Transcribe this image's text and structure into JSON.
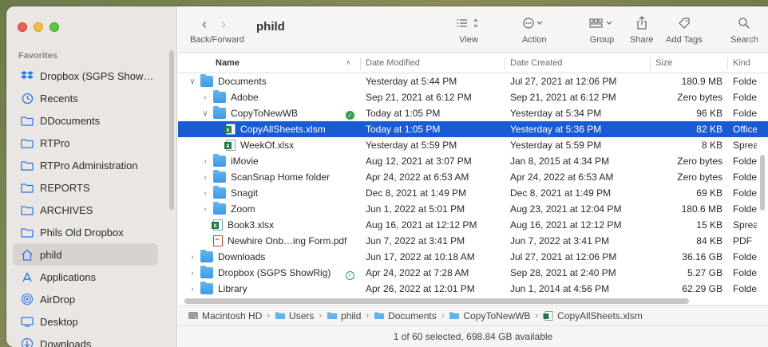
{
  "sidebar": {
    "heading": "Favorites",
    "items": [
      {
        "label": "Dropbox (SGPS Show…",
        "icon": "dropbox-icon",
        "active": false
      },
      {
        "label": "Recents",
        "icon": "clock-icon",
        "active": false
      },
      {
        "label": "DDocuments",
        "icon": "folder-icon",
        "active": false
      },
      {
        "label": "RTPro",
        "icon": "folder-icon",
        "active": false
      },
      {
        "label": "RTPro Administration",
        "icon": "folder-icon",
        "active": false
      },
      {
        "label": "REPORTS",
        "icon": "folder-icon",
        "active": false
      },
      {
        "label": "ARCHIVES",
        "icon": "folder-icon",
        "active": false
      },
      {
        "label": "Phils Old Dropbox",
        "icon": "folder-icon",
        "active": false
      },
      {
        "label": "phild",
        "icon": "home-icon",
        "active": true
      },
      {
        "label": "Applications",
        "icon": "applications-icon",
        "active": false
      },
      {
        "label": "AirDrop",
        "icon": "airdrop-icon",
        "active": false
      },
      {
        "label": "Desktop",
        "icon": "desktop-icon",
        "active": false
      },
      {
        "label": "Downloads",
        "icon": "downloads-icon",
        "active": false
      }
    ]
  },
  "toolbar": {
    "back_forward_label": "Back/Forward",
    "title": "phild",
    "view_label": "View",
    "action_label": "Action",
    "group_label": "Group",
    "share_label": "Share",
    "add_tags_label": "Add Tags",
    "search_label": "Search"
  },
  "columns": {
    "name": "Name",
    "date_modified": "Date Modified",
    "date_created": "Date Created",
    "size": "Size",
    "kind": "Kind"
  },
  "rows": [
    {
      "name": "Documents",
      "level": 0,
      "chevron": "down",
      "type": "folder",
      "modified": "Yesterday at 5:44 PM",
      "created": "Jul 27, 2021 at 12:06 PM",
      "size": "180.9 MB",
      "kind": "Folder",
      "selected": false,
      "tag": ""
    },
    {
      "name": "Adobe",
      "level": 1,
      "chevron": "right",
      "type": "folder",
      "modified": "Sep 21, 2021 at 6:12 PM",
      "created": "Sep 21, 2021 at 6:12 PM",
      "size": "Zero bytes",
      "kind": "Folder",
      "selected": false,
      "tag": ""
    },
    {
      "name": "CopyToNewWB",
      "level": 1,
      "chevron": "down",
      "type": "folder",
      "modified": "Today at 1:05 PM",
      "created": "Yesterday at 5:34 PM",
      "size": "96 KB",
      "kind": "Folder",
      "selected": false,
      "tag": "synced"
    },
    {
      "name": "CopyAllSheets.xlsm",
      "level": 2,
      "chevron": "",
      "type": "xls",
      "modified": "Today at 1:05 PM",
      "created": "Yesterday at 5:36 PM",
      "size": "82 KB",
      "kind": "Office",
      "selected": true,
      "tag": ""
    },
    {
      "name": "WeekOf.xlsx",
      "level": 2,
      "chevron": "",
      "type": "xls",
      "modified": "Yesterday at 5:59 PM",
      "created": "Yesterday at 5:59 PM",
      "size": "8 KB",
      "kind": "Spreadsheet",
      "selected": false,
      "tag": ""
    },
    {
      "name": "iMovie",
      "level": 1,
      "chevron": "right",
      "type": "folder",
      "modified": "Aug 12, 2021 at 3:07 PM",
      "created": "Jan 8, 2015 at 4:34 PM",
      "size": "Zero bytes",
      "kind": "Folder",
      "selected": false,
      "tag": ""
    },
    {
      "name": "ScanSnap Home folder",
      "level": 1,
      "chevron": "right",
      "type": "folder",
      "modified": "Apr 24, 2022 at 6:53 AM",
      "created": "Apr 24, 2022 at 6:53 AM",
      "size": "Zero bytes",
      "kind": "Folder",
      "selected": false,
      "tag": ""
    },
    {
      "name": "Snagit",
      "level": 1,
      "chevron": "right",
      "type": "folder",
      "modified": "Dec 8, 2021 at 1:49 PM",
      "created": "Dec 8, 2021 at 1:49 PM",
      "size": "69 KB",
      "kind": "Folder",
      "selected": false,
      "tag": ""
    },
    {
      "name": "Zoom",
      "level": 1,
      "chevron": "right",
      "type": "folder",
      "modified": "Jun 1, 2022 at 5:01 PM",
      "created": "Aug 23, 2021 at 12:04 PM",
      "size": "180.6 MB",
      "kind": "Folder",
      "selected": false,
      "tag": ""
    },
    {
      "name": "Book3.xlsx",
      "level": 1,
      "chevron": "",
      "type": "xls",
      "modified": "Aug 16, 2021 at 12:12 PM",
      "created": "Aug 16, 2021 at 12:12 PM",
      "size": "15 KB",
      "kind": "Spreadsheet",
      "selected": false,
      "tag": ""
    },
    {
      "name": "Newhire Onb…ing Form.pdf",
      "level": 1,
      "chevron": "",
      "type": "pdf",
      "modified": "Jun 7, 2022 at 3:41 PM",
      "created": "Jun 7, 2022 at 3:41 PM",
      "size": "84 KB",
      "kind": "PDF",
      "selected": false,
      "tag": ""
    },
    {
      "name": "Downloads",
      "level": 0,
      "chevron": "right",
      "type": "folder",
      "modified": "Jun 17, 2022 at 10:18 AM",
      "created": "Jul 27, 2021 at 12:06 PM",
      "size": "36.16 GB",
      "kind": "Folder",
      "selected": false,
      "tag": ""
    },
    {
      "name": "Dropbox (SGPS ShowRig)",
      "level": 0,
      "chevron": "right",
      "type": "folder",
      "modified": "Apr 24, 2022 at 7:28 AM",
      "created": "Sep 28, 2021 at 2:40 PM",
      "size": "5.27 GB",
      "kind": "Folder",
      "selected": false,
      "tag": "synced-outline"
    },
    {
      "name": "Library",
      "level": 0,
      "chevron": "right",
      "type": "folder",
      "modified": "Apr 26, 2022 at 12:01 PM",
      "created": "Jun 1, 2014 at 4:56 PM",
      "size": "62.29 GB",
      "kind": "Folder",
      "selected": false,
      "tag": ""
    }
  ],
  "pathbar": [
    {
      "label": "Macintosh HD",
      "icon": "disk-icon"
    },
    {
      "label": "Users",
      "icon": "folder-icon"
    },
    {
      "label": "phild",
      "icon": "folder-icon"
    },
    {
      "label": "Documents",
      "icon": "folder-icon"
    },
    {
      "label": "CopyToNewWB",
      "icon": "folder-icon"
    },
    {
      "label": "CopyAllSheets.xlsm",
      "icon": "excel-file-icon"
    }
  ],
  "status": "1 of 60 selected, 698.84 GB available",
  "colors": {
    "selection": "#1a5bd3",
    "folder": "#3d9be6",
    "sidebar_bg": "#e9e6e3"
  }
}
